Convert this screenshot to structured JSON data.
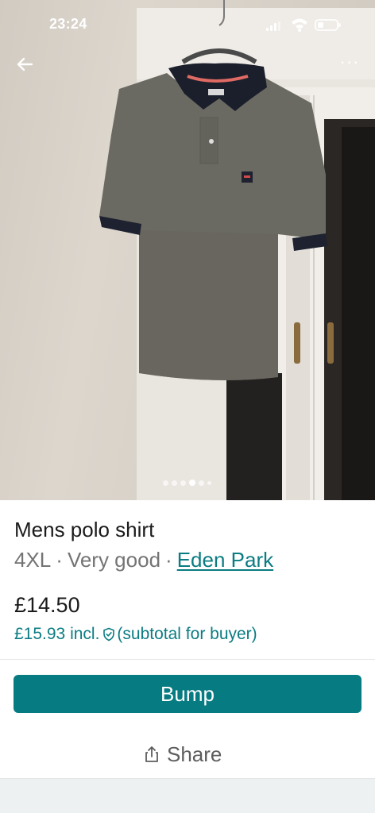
{
  "status_bar": {
    "time": "23:24",
    "icons": [
      "cellular-signal-icon",
      "wifi-icon",
      "battery-icon"
    ]
  },
  "photo": {
    "description_icon": "product-photo",
    "nav": {
      "back_icon": "arrow-left-icon",
      "more_icon": "more-options-icon",
      "more_label": "···"
    },
    "carousel": {
      "total": 6,
      "active_index": 3
    }
  },
  "item": {
    "title": "Mens polo shirt",
    "size": "4XL",
    "separator": "·",
    "condition": "Very good",
    "brand": "Eden Park",
    "price": "£14.50",
    "buyer_price": "£15.93 incl.",
    "buyer_note": "(subtotal for buyer)"
  },
  "actions": {
    "bump_label": "Bump",
    "share_label": "Share"
  },
  "colors": {
    "accent": "#077b82",
    "link": "#0a7c82",
    "text": "#1b1b1b",
    "muted": "#747474"
  }
}
